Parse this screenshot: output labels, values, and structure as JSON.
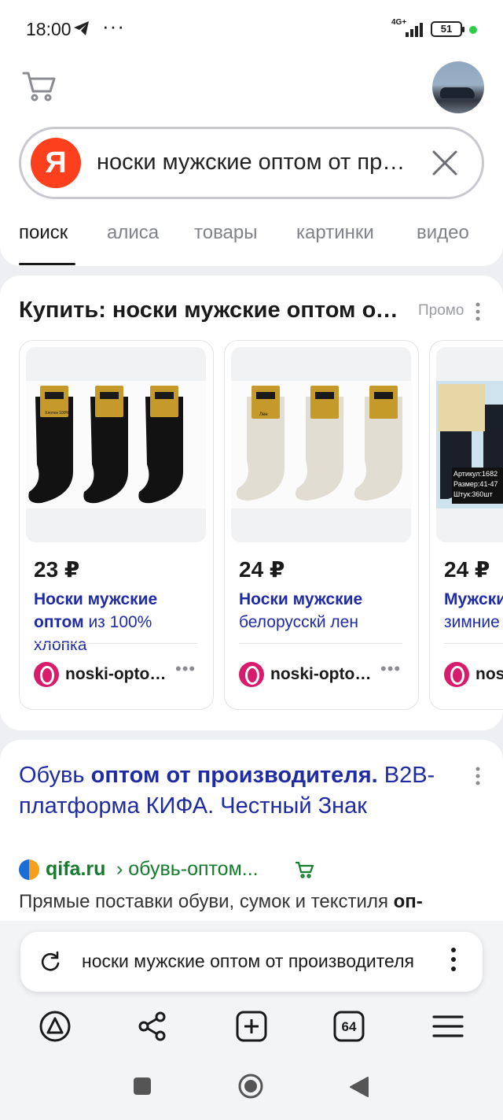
{
  "status": {
    "time": "18:00",
    "dots": "···",
    "network": "4G+",
    "battery": "51"
  },
  "search": {
    "query": "носки мужские оптом от производителя",
    "logo": "Я"
  },
  "tabs": [
    "поиск",
    "алиса",
    "товары",
    "картинки",
    "видео"
  ],
  "promo": {
    "title": "Купить: носки мужские оптом от производителя",
    "tag": "Промо",
    "products": [
      {
        "price": "23 ₽",
        "title_bold": "Носки мужские оптом",
        "title_rest": " из 100% хлопка",
        "shop": "noski-optom.ru"
      },
      {
        "price": "24 ₽",
        "title_bold": "Носки мужские",
        "title_rest": " белорусскй лен",
        "shop": "noski-optom.ru"
      },
      {
        "price": "24 ₽",
        "title_bold": "Мужские",
        "title_rest": " зимние",
        "shop": "noski-optom.ru"
      }
    ],
    "photo_labels": [
      "Хлопок 100%",
      "Лен",
      "Артикул:1682",
      "Размер:41-47",
      "Штук:360шт"
    ]
  },
  "result": {
    "title_part1": "Обувь ",
    "title_bold": "оптом от производителя.",
    "title_part2": " B2B-платформа КИФА. Честный Знак",
    "domain": "qifa.ru",
    "path": "› обувь-оптом...",
    "snippet": "Прямые поставки обуви, сумок и текстиля ",
    "snippet_bold": "оп-"
  },
  "omnibox": {
    "text": "носки мужские оптом от производителя"
  },
  "nav": {
    "tabs_count": "64"
  }
}
